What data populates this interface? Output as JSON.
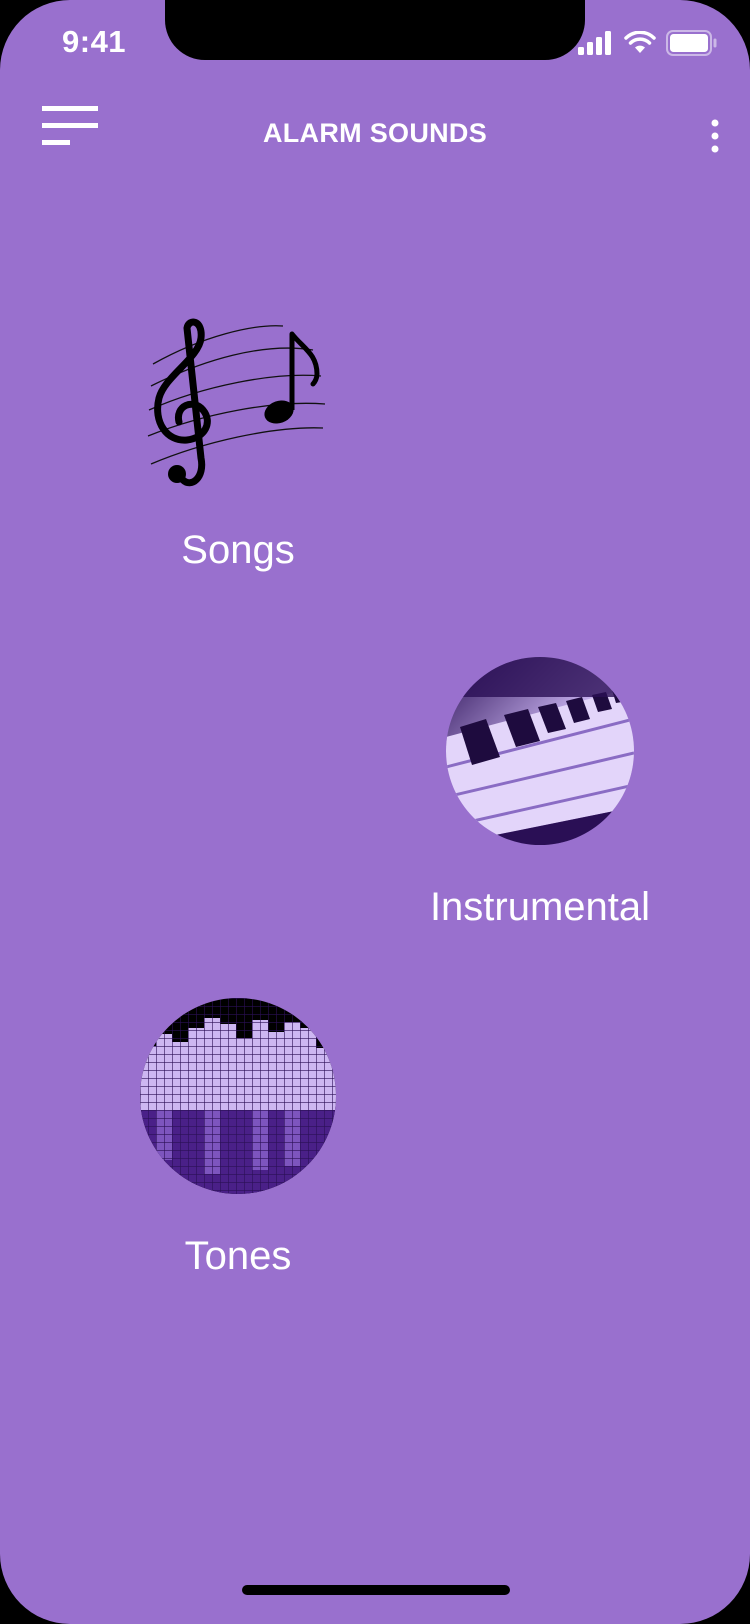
{
  "status_bar": {
    "time": "9:41"
  },
  "header": {
    "title": "ALARM SOUNDS",
    "menu_icon": "hamburger-lines-icon",
    "more_icon": "vertical-ellipsis-icon"
  },
  "categories": [
    {
      "label": "Songs",
      "icon": "music-notes-icon"
    },
    {
      "label": "Instrumental",
      "icon": "piano-keys-image"
    },
    {
      "label": "Tones",
      "icon": "equalizer-bars-image"
    }
  ],
  "colors": {
    "background": "#9970CE",
    "text": "#FFFFFF",
    "accent_dark": "#3A1670",
    "accent_light": "#E6D9FF"
  }
}
